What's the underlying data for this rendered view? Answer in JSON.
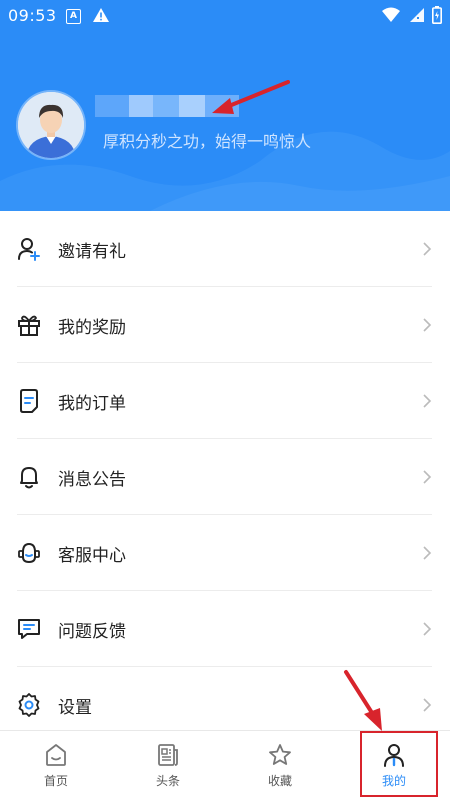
{
  "status_bar": {
    "time": "09:53",
    "a_badge": "A"
  },
  "profile": {
    "slogan": "厚积分秒之功，始得一鸣惊人"
  },
  "menu": {
    "items": [
      {
        "label": "邀请有礼",
        "icon": "add-user-icon"
      },
      {
        "label": "我的奖励",
        "icon": "gift-icon"
      },
      {
        "label": "我的订单",
        "icon": "order-icon"
      },
      {
        "label": "消息公告",
        "icon": "bell-icon"
      },
      {
        "label": "客服中心",
        "icon": "customer-service-icon"
      },
      {
        "label": "问题反馈",
        "icon": "feedback-icon"
      },
      {
        "label": "设置",
        "icon": "gear-icon"
      }
    ]
  },
  "tabbar": {
    "tabs": [
      {
        "label": "首页",
        "icon": "home-icon"
      },
      {
        "label": "头条",
        "icon": "news-icon"
      },
      {
        "label": "收藏",
        "icon": "star-icon"
      },
      {
        "label": "我的",
        "icon": "profile-icon"
      }
    ],
    "active_tab": "我的"
  },
  "colors": {
    "accent": "#2b8cf7",
    "highlight": "#d8242c"
  }
}
